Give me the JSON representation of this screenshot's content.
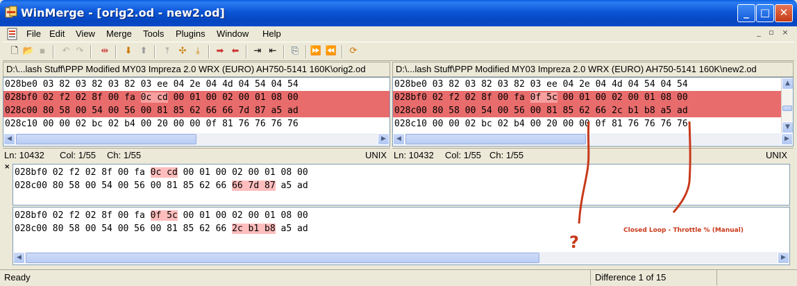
{
  "window": {
    "title": "WinMerge - [orig2.od - new2.od]",
    "accent": "#0b55d6",
    "controls": {
      "minimize": "_",
      "maximize": "□",
      "close": "✕"
    }
  },
  "menu": {
    "items": [
      "File",
      "Edit",
      "View",
      "Merge",
      "Tools",
      "Plugins",
      "Window",
      "Help"
    ],
    "mdi_controls": [
      "_",
      "▫",
      "×"
    ]
  },
  "toolbar": {
    "icons": [
      "new-icon",
      "open-icon",
      "save-icon",
      "undo-icon",
      "redo-icon",
      "options-icon",
      "next-diff-icon",
      "prev-diff-icon",
      "first-diff-icon",
      "current-diff-icon",
      "last-diff-icon",
      "copy-right-icon",
      "copy-left-icon",
      "copy-right-advance-icon",
      "copy-left-advance-icon",
      "compare-icon",
      "all-right-icon",
      "all-left-icon",
      "refresh-icon"
    ]
  },
  "left": {
    "path": "D:\\...lash Stuff\\PPP Modified MY03 Impreza 2.0 WRX (EURO) AH750-5141 160K\\orig2.od",
    "lines": [
      {
        "pre": "028be0 03 82 03 82 03 82 03 ee 04 2e 04 4d 04 54 04 54",
        "hl": "",
        "post": ""
      },
      {
        "pre": "028bf0 02 f2 02 8f 00 fa ",
        "hl": "0c cd",
        "post": " 00 01 00 02 00 01 08 00"
      },
      {
        "pre": "028c00 80 58 00 54 00 56 00 81 85 62 66 66 7d 87 a5 ad",
        "hl": "",
        "post": ""
      },
      {
        "pre": "028c10 00 00 02 bc 02 b4 00 20 00 00 0f 81 76 76 76 76",
        "hl": "",
        "post": ""
      }
    ],
    "status": {
      "ln": "Ln: 10432",
      "col": "Col: 1/55",
      "ch": "Ch: 1/55",
      "eol": "UNIX"
    }
  },
  "right": {
    "path": "D:\\...lash Stuff\\PPP Modified MY03 Impreza 2.0 WRX (EURO) AH750-5141 160K\\new2.od",
    "lines": [
      {
        "pre": "028be0 03 82 03 82 03 82 03 ee 04 2e 04 4d 04 54 04 54",
        "hl": "",
        "post": ""
      },
      {
        "pre": "028bf0 02 f2 02 8f 00 fa ",
        "hl": "0f 5c",
        "post": " 00 01 00 02 00 01 08 00"
      },
      {
        "pre": "028c00 80 58 00 54 00 56 00 81 85 62 66 2c b1 b8 a5 ad",
        "hl": "",
        "post": ""
      },
      {
        "pre": "028c10 00 00 02 bc 02 b4 00 20 00 00 0f 81 76 76 76 76",
        "hl": "",
        "post": ""
      }
    ],
    "status": {
      "ln": "Ln: 10432",
      "col": "Col: 1/55",
      "ch": "Ch: 1/55",
      "eol": "UNIX"
    }
  },
  "detail_top": {
    "line1": {
      "pre": "028bf0 02 f2 02 8f 00 fa ",
      "hl": "0c cd",
      "post": " 00 01 00 02 00 01 08 00"
    },
    "line2": {
      "pre": "028c00 80 58 00 54 00 56 00 81 85 62 66 ",
      "hl": "66 7d 87",
      "post": " a5 ad"
    }
  },
  "detail_bottom": {
    "line1": {
      "pre": "028bf0 02 f2 02 8f 00 fa ",
      "hl": "0f 5c",
      "post": " 00 01 00 02 00 01 08 00"
    },
    "line2": {
      "pre": "028c00 80 58 00 54 00 56 00 81 85 62 66 ",
      "hl": "2c b1 b8",
      "post": " a5 ad"
    }
  },
  "statusbar": {
    "left": "Ready",
    "diff": "Difference 1 of 15"
  },
  "annotation": {
    "question": "?",
    "label": "Closed Loop - Throttle % (Manual)",
    "color": "#c8391a"
  },
  "colors": {
    "diff_line": "#ef8d8d",
    "diff_word": "#ffbdbd"
  }
}
